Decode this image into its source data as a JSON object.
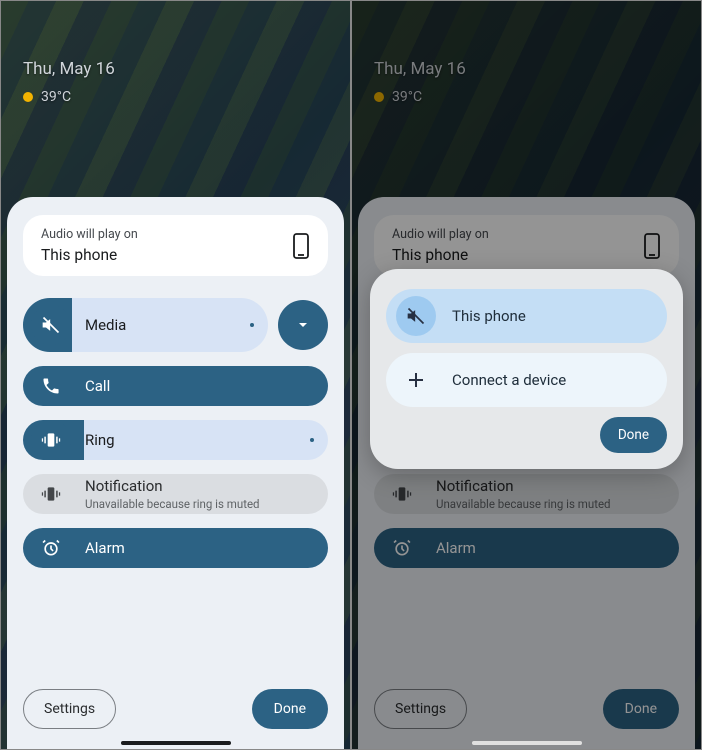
{
  "lock": {
    "date": "Thu, May 16",
    "temp": "39°C"
  },
  "output": {
    "label": "Audio will play on",
    "value": "This phone"
  },
  "volumes": {
    "media": {
      "label": "Media",
      "fill_pct": 20
    },
    "call": {
      "label": "Call",
      "fill_pct": 100
    },
    "ring": {
      "label": "Ring",
      "fill_pct": 20
    },
    "notification": {
      "label": "Notification",
      "sub": "Unavailable because ring is muted"
    },
    "alarm": {
      "label": "Alarm",
      "fill_pct": 100
    }
  },
  "footer": {
    "settings": "Settings",
    "done": "Done"
  },
  "dialog": {
    "this_phone": "This phone",
    "connect": "Connect a device",
    "done": "Done"
  },
  "colors": {
    "accent": "#2c6284",
    "track": "#d7e3f5",
    "sheet": "#ecf0f5"
  }
}
